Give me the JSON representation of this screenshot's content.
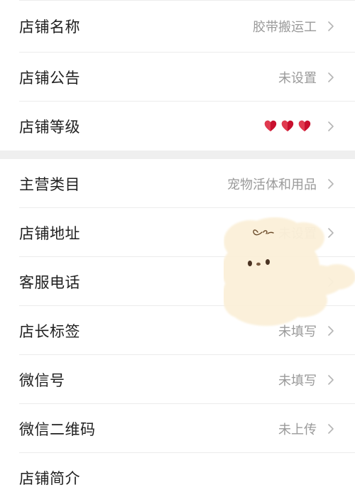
{
  "section1": {
    "rows": [
      {
        "label": "店铺名称",
        "value": "胶带搬运工"
      },
      {
        "label": "店铺公告",
        "value": "未设置"
      },
      {
        "label": "店铺等级",
        "hearts": 3
      }
    ]
  },
  "section2": {
    "rows": [
      {
        "label": "主营类目",
        "value": "宠物活体和用品"
      },
      {
        "label": "店铺地址",
        "value": "未设置"
      },
      {
        "label": "客服电话",
        "value": ""
      },
      {
        "label": "店长标签",
        "value": "未填写"
      },
      {
        "label": "微信号",
        "value": "未填写"
      },
      {
        "label": "微信二维码",
        "value": "未上传"
      },
      {
        "label": "店铺简介",
        "value": ""
      }
    ]
  },
  "colors": {
    "heart": "#c8102e",
    "divider": "#ececec",
    "section_gap": "#efefef"
  },
  "icons": {
    "chevron": "chevron-right-icon",
    "heart": "heart-icon",
    "sticker": "puppy-sticker"
  }
}
